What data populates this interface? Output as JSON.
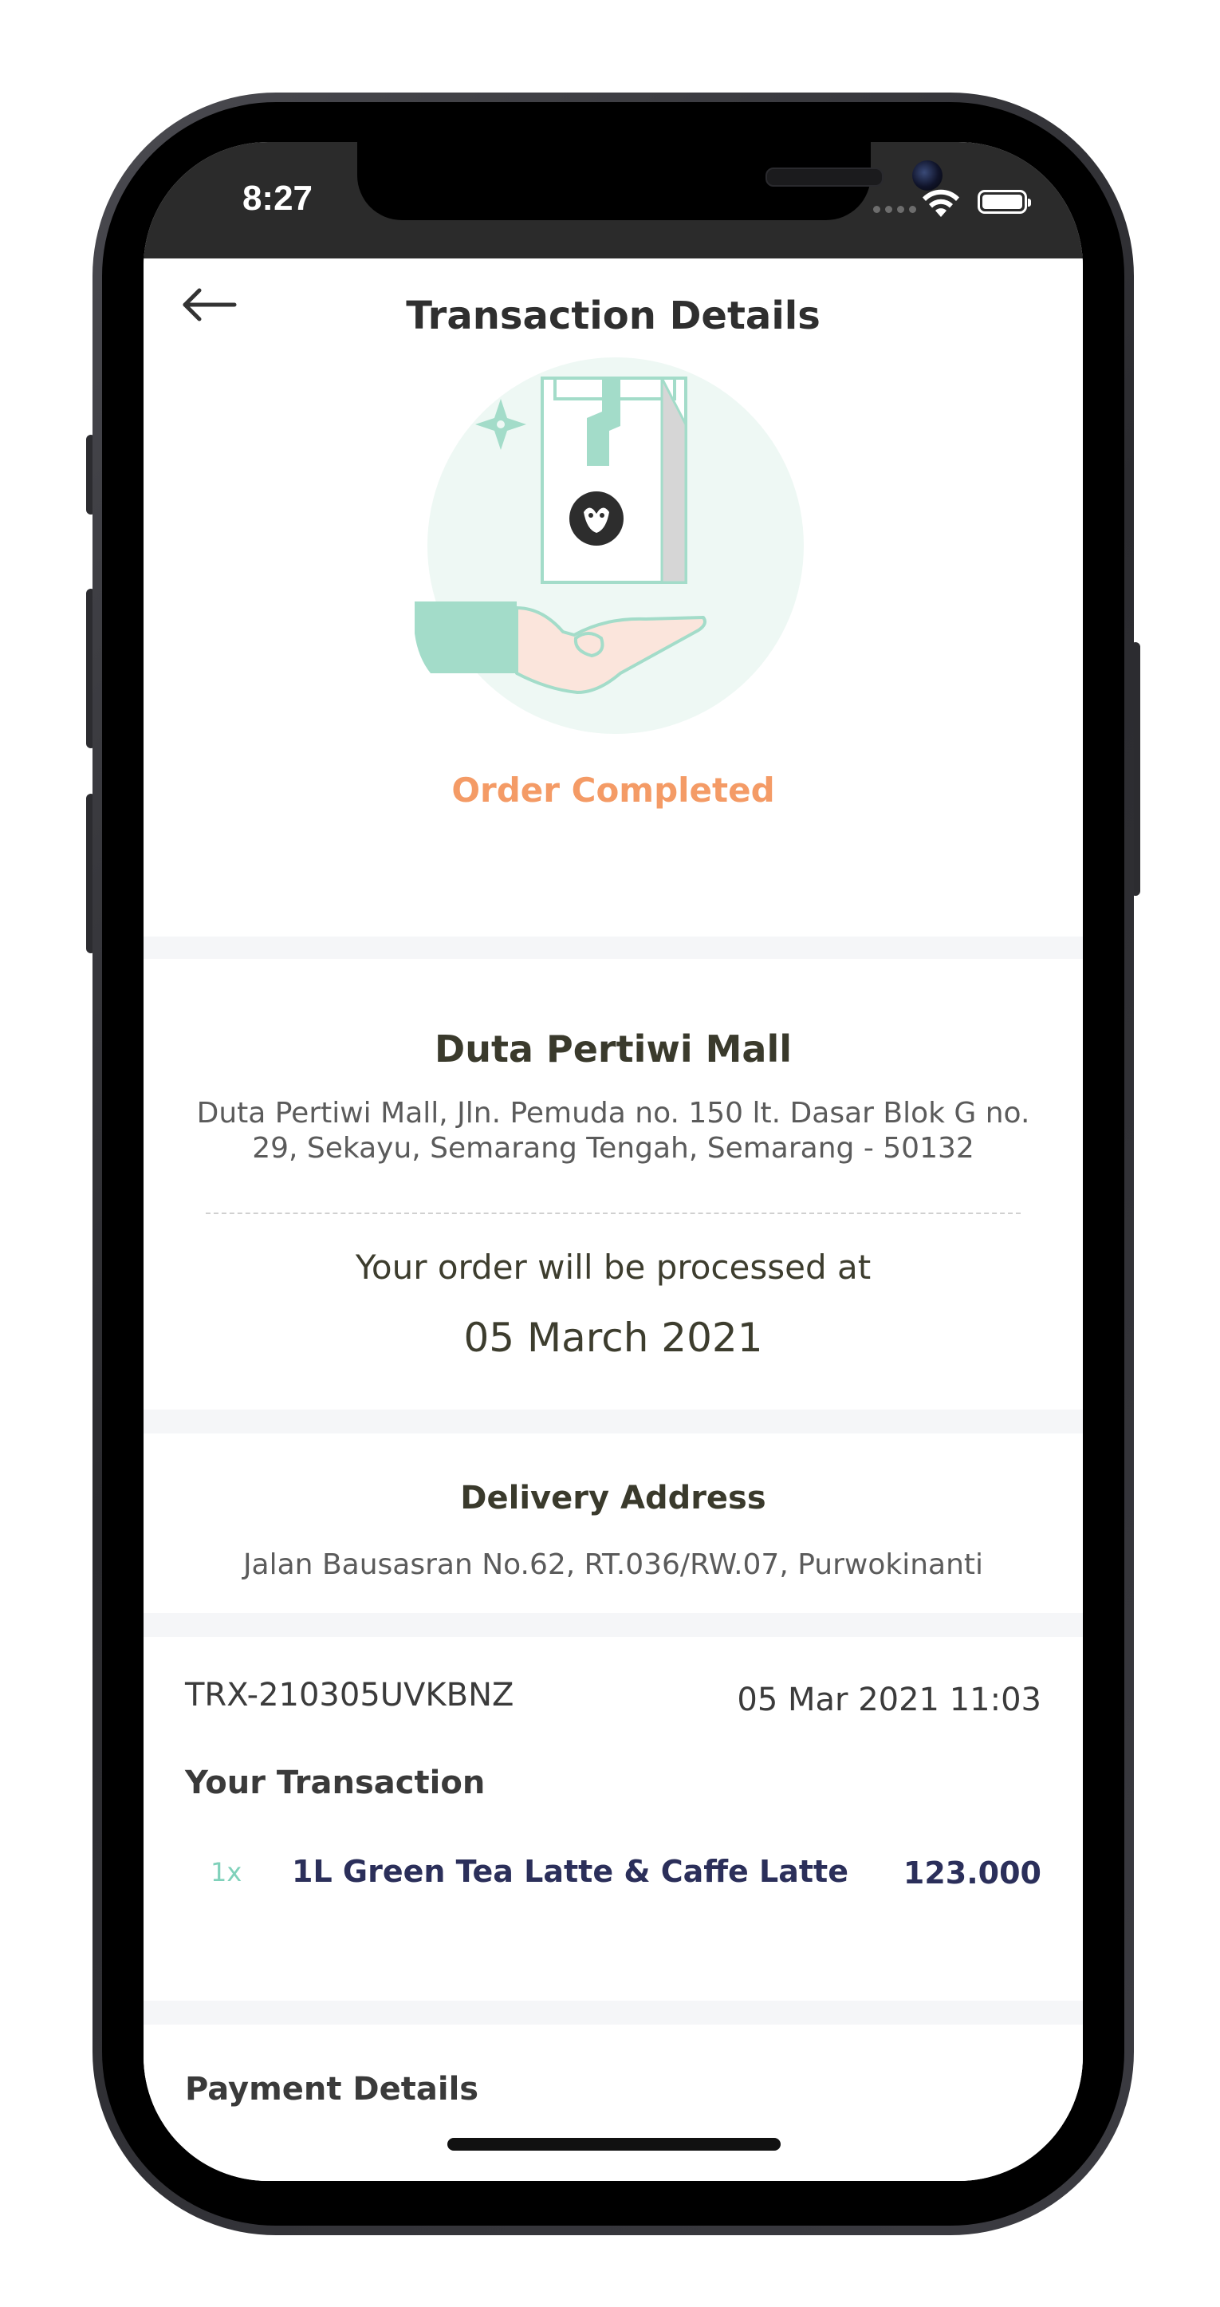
{
  "status_bar": {
    "time": "8:27"
  },
  "header": {
    "title": "Transaction Details",
    "back_icon": "arrow-left-icon"
  },
  "order_status": {
    "label": "Order Completed",
    "color": "#f49b66",
    "illustration_icon": "hand-receiving-coffee-bag-icon"
  },
  "store": {
    "name": "Duta Pertiwi Mall",
    "address": "Duta Pertiwi Mall, Jln. Pemuda no. 150 lt. Dasar Blok G no. 29, Sekayu, Semarang Tengah, Semarang - 50132",
    "processed_label": "Your order will be processed at",
    "processed_date": "05 March 2021"
  },
  "delivery": {
    "title": "Delivery Address",
    "address": "Jalan Bausasran No.62, RT.036/RW.07, Purwokinanti"
  },
  "transaction": {
    "id": "TRX-210305UVKBNZ",
    "datetime": "05 Mar 2021 11:03",
    "title": "Your Transaction",
    "items": [
      {
        "qty": "1x",
        "name": "1L Green Tea Latte & Caffe Latte",
        "price": "123.000"
      }
    ]
  },
  "payment": {
    "title": "Payment Details"
  },
  "colors": {
    "accent_green": "#a3dcc9",
    "status_orange": "#f49b66",
    "item_text": "#2b2f5a",
    "section_gap": "#f5f6f8"
  }
}
